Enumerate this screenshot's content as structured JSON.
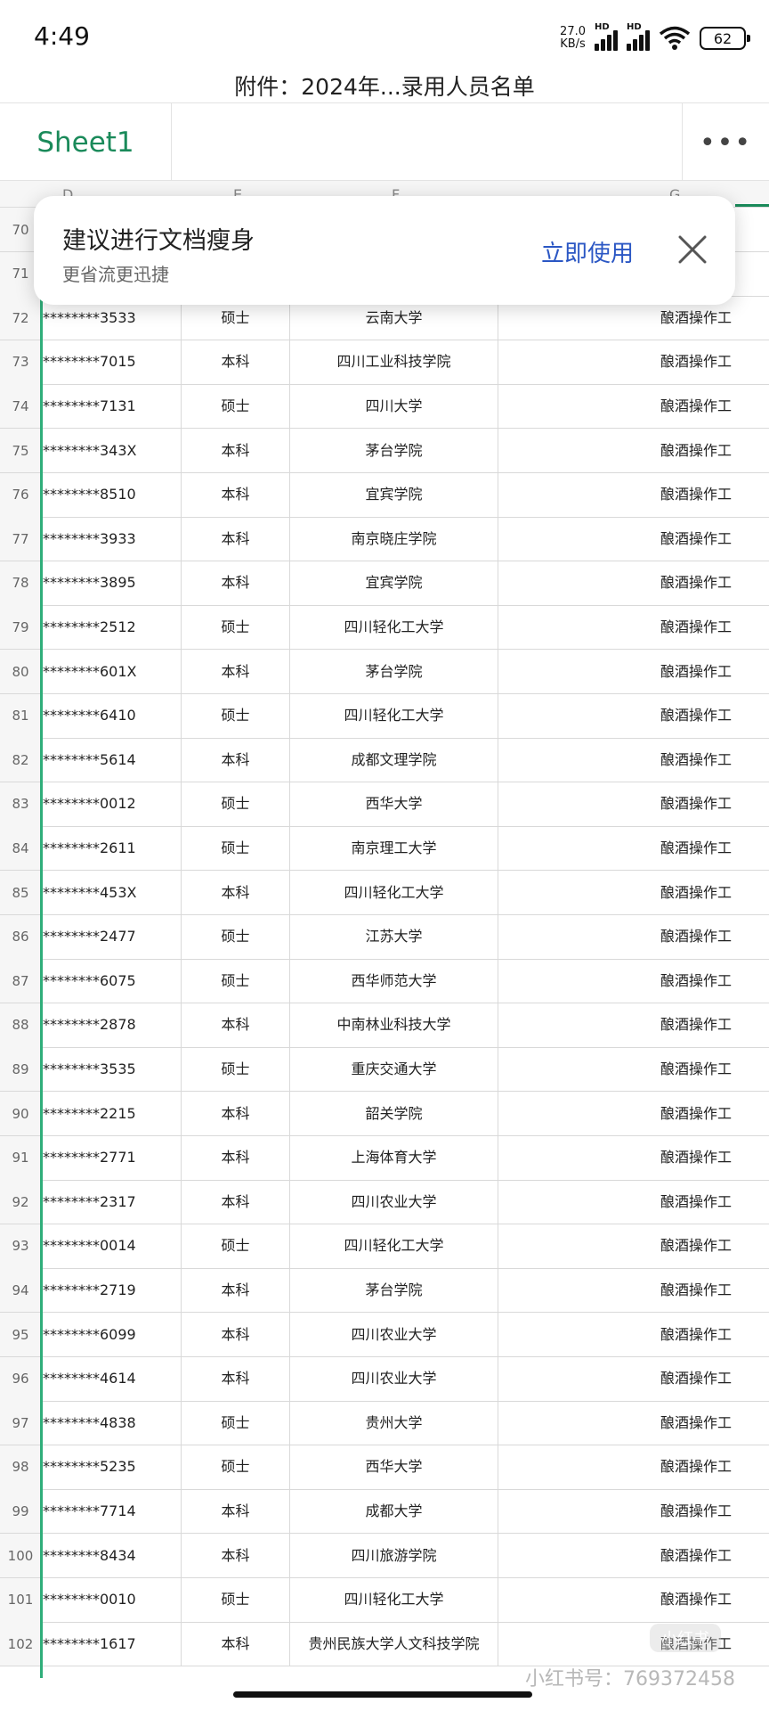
{
  "status": {
    "time": "4:49",
    "net_speed_value": "27.0",
    "net_speed_unit": "KB/s",
    "hd_label": "HD",
    "battery": "62"
  },
  "doc_title": "附件：2024年...录用人员名单",
  "sheet_tab": "Sheet1",
  "more_label": "•••",
  "columns": [
    "D",
    "E",
    "F",
    "G"
  ],
  "popup": {
    "title": "建议进行文档瘦身",
    "subtitle": "更省流更迅捷",
    "action": "立即使用"
  },
  "rows": [
    {
      "num": "70",
      "id": "",
      "degree": "",
      "university": "",
      "job": ""
    },
    {
      "num": "71",
      "id": "",
      "degree": "",
      "university": "",
      "job": ""
    },
    {
      "num": "72",
      "id": "********3533",
      "degree": "硕士",
      "university": "云南大学",
      "job": "酿酒操作工"
    },
    {
      "num": "73",
      "id": "********7015",
      "degree": "本科",
      "university": "四川工业科技学院",
      "job": "酿酒操作工"
    },
    {
      "num": "74",
      "id": "********7131",
      "degree": "硕士",
      "university": "四川大学",
      "job": "酿酒操作工"
    },
    {
      "num": "75",
      "id": "********343X",
      "degree": "本科",
      "university": "茅台学院",
      "job": "酿酒操作工"
    },
    {
      "num": "76",
      "id": "********8510",
      "degree": "本科",
      "university": "宜宾学院",
      "job": "酿酒操作工"
    },
    {
      "num": "77",
      "id": "********3933",
      "degree": "本科",
      "university": "南京晓庄学院",
      "job": "酿酒操作工"
    },
    {
      "num": "78",
      "id": "********3895",
      "degree": "本科",
      "university": "宜宾学院",
      "job": "酿酒操作工"
    },
    {
      "num": "79",
      "id": "********2512",
      "degree": "硕士",
      "university": "四川轻化工大学",
      "job": "酿酒操作工"
    },
    {
      "num": "80",
      "id": "********601X",
      "degree": "本科",
      "university": "茅台学院",
      "job": "酿酒操作工"
    },
    {
      "num": "81",
      "id": "********6410",
      "degree": "硕士",
      "university": "四川轻化工大学",
      "job": "酿酒操作工"
    },
    {
      "num": "82",
      "id": "********5614",
      "degree": "本科",
      "university": "成都文理学院",
      "job": "酿酒操作工"
    },
    {
      "num": "83",
      "id": "********0012",
      "degree": "硕士",
      "university": "西华大学",
      "job": "酿酒操作工"
    },
    {
      "num": "84",
      "id": "********2611",
      "degree": "硕士",
      "university": "南京理工大学",
      "job": "酿酒操作工"
    },
    {
      "num": "85",
      "id": "********453X",
      "degree": "本科",
      "university": "四川轻化工大学",
      "job": "酿酒操作工"
    },
    {
      "num": "86",
      "id": "********2477",
      "degree": "硕士",
      "university": "江苏大学",
      "job": "酿酒操作工"
    },
    {
      "num": "87",
      "id": "********6075",
      "degree": "硕士",
      "university": "西华师范大学",
      "job": "酿酒操作工"
    },
    {
      "num": "88",
      "id": "********2878",
      "degree": "本科",
      "university": "中南林业科技大学",
      "job": "酿酒操作工"
    },
    {
      "num": "89",
      "id": "********3535",
      "degree": "硕士",
      "university": "重庆交通大学",
      "job": "酿酒操作工"
    },
    {
      "num": "90",
      "id": "********2215",
      "degree": "本科",
      "university": "韶关学院",
      "job": "酿酒操作工"
    },
    {
      "num": "91",
      "id": "********2771",
      "degree": "本科",
      "university": "上海体育大学",
      "job": "酿酒操作工"
    },
    {
      "num": "92",
      "id": "********2317",
      "degree": "本科",
      "university": "四川农业大学",
      "job": "酿酒操作工"
    },
    {
      "num": "93",
      "id": "********0014",
      "degree": "硕士",
      "university": "四川轻化工大学",
      "job": "酿酒操作工"
    },
    {
      "num": "94",
      "id": "********2719",
      "degree": "本科",
      "university": "茅台学院",
      "job": "酿酒操作工"
    },
    {
      "num": "95",
      "id": "********6099",
      "degree": "本科",
      "university": "四川农业大学",
      "job": "酿酒操作工"
    },
    {
      "num": "96",
      "id": "********4614",
      "degree": "本科",
      "university": "四川农业大学",
      "job": "酿酒操作工"
    },
    {
      "num": "97",
      "id": "********4838",
      "degree": "硕士",
      "university": "贵州大学",
      "job": "酿酒操作工"
    },
    {
      "num": "98",
      "id": "********5235",
      "degree": "硕士",
      "university": "西华大学",
      "job": "酿酒操作工"
    },
    {
      "num": "99",
      "id": "********7714",
      "degree": "本科",
      "university": "成都大学",
      "job": "酿酒操作工"
    },
    {
      "num": "100",
      "id": "********8434",
      "degree": "本科",
      "university": "四川旅游学院",
      "job": "酿酒操作工"
    },
    {
      "num": "101",
      "id": "********0010",
      "degree": "硕士",
      "university": "四川轻化工大学",
      "job": "酿酒操作工"
    },
    {
      "num": "102",
      "id": "********1617",
      "degree": "本科",
      "university": "贵州民族大学人文科技学院",
      "job": "酿酒操作工"
    }
  ],
  "watermark": "小红书号：769372458",
  "watermark_logo": "小红书"
}
